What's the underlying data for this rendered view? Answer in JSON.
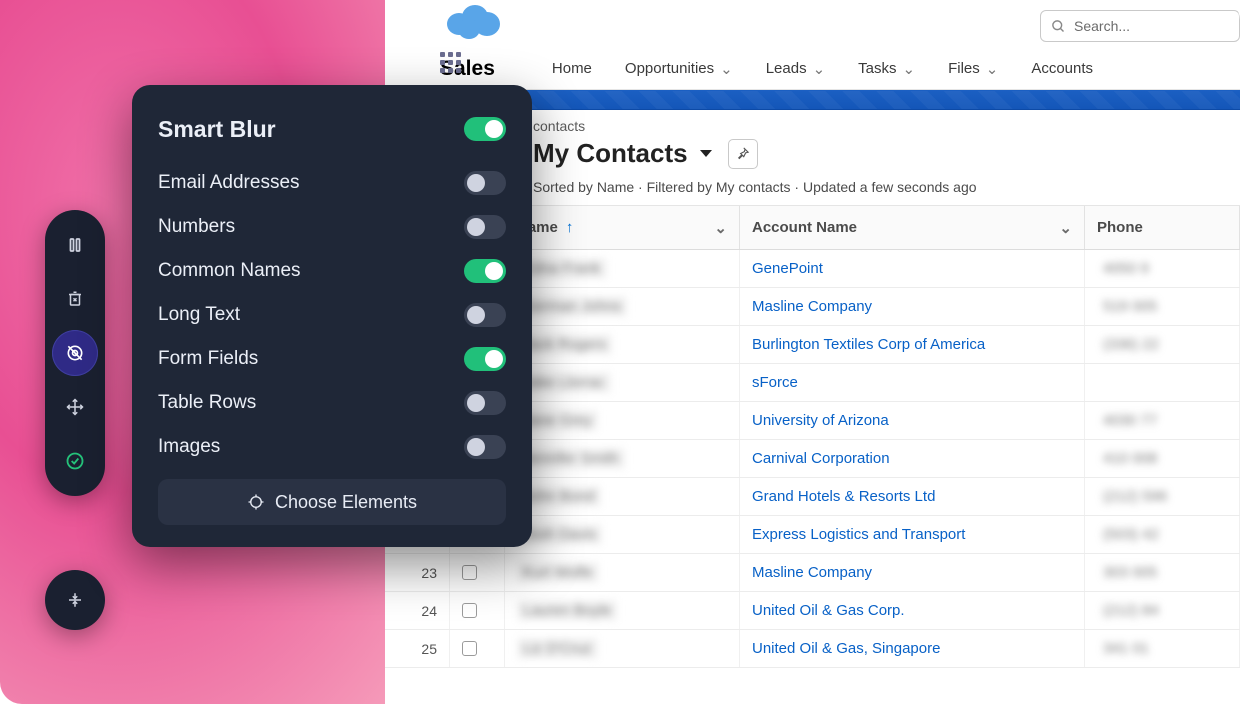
{
  "panel": {
    "title": "Smart Blur",
    "main_enabled": true,
    "options": [
      {
        "label": "Email Addresses",
        "enabled": false
      },
      {
        "label": "Numbers",
        "enabled": false
      },
      {
        "label": "Common Names",
        "enabled": true
      },
      {
        "label": "Long Text",
        "enabled": false
      },
      {
        "label": "Form Fields",
        "enabled": true
      },
      {
        "label": "Table Rows",
        "enabled": false
      },
      {
        "label": "Images",
        "enabled": false
      }
    ],
    "choose_label": "Choose Elements"
  },
  "search": {
    "placeholder": "Search..."
  },
  "app_name": "Sales",
  "nav": [
    "Home",
    "Opportunities",
    "Leads",
    "Tasks",
    "Files",
    "Accounts"
  ],
  "list": {
    "small_label": "contacts",
    "title": "My Contacts",
    "subtitle": "Sorted by Name · Filtered by My contacts · Updated a few seconds ago",
    "columns": {
      "name": "Name",
      "account": "Account Name",
      "phone": "Phone"
    }
  },
  "rows": [
    {
      "num": "",
      "name": "Edna Frank",
      "account": "GenePoint",
      "phone": "4050  9"
    },
    {
      "num": "",
      "name": "German Johns",
      "account": "Masline Company",
      "phone": "519 005"
    },
    {
      "num": "",
      "name": "Jack Rogers",
      "account": "Burlington Textiles Corp of America",
      "phone": "(336) 22"
    },
    {
      "num": "",
      "name": "Jake Llorrac",
      "account": "sForce",
      "phone": ""
    },
    {
      "num": "",
      "name": "Jane Grey",
      "account": "University of Arizona",
      "phone": "4030 77"
    },
    {
      "num": "",
      "name": "Jennifer Smith",
      "account": "Carnival Corporation",
      "phone": "410 008"
    },
    {
      "num": "",
      "name": "John Bond",
      "account": "Grand Hotels & Resorts Ltd",
      "phone": "(212) 596"
    },
    {
      "num": "22",
      "name": "Josh Davis",
      "account": "Express Logistics and Transport",
      "phone": "(503) 42"
    },
    {
      "num": "23",
      "name": "Kurt Wolfe",
      "account": "Masline Company",
      "phone": "303 005"
    },
    {
      "num": "24",
      "name": "Lauren Boyle",
      "account": "United Oil & Gas Corp.",
      "phone": "(212) 84"
    },
    {
      "num": "25",
      "name": "Liz D'Cruz",
      "account": "United Oil & Gas, Singapore",
      "phone": "341 01"
    }
  ]
}
